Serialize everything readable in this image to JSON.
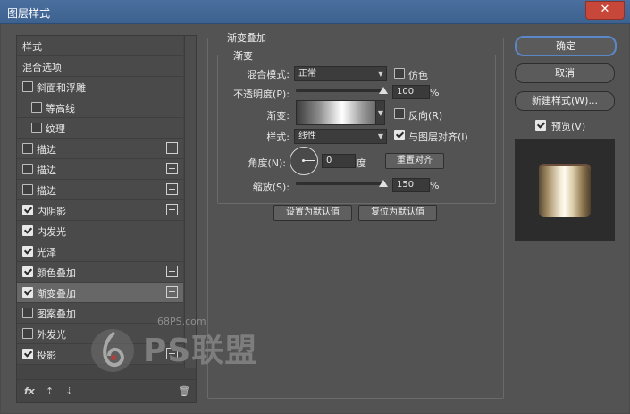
{
  "window": {
    "title": "图层样式",
    "close_icon": "close-icon"
  },
  "styles_list": {
    "items": [
      {
        "label": "样式",
        "has_checkbox": false,
        "checked": false,
        "has_plus": false,
        "selected": false,
        "indent": 0
      },
      {
        "label": "混合选项",
        "has_checkbox": false,
        "checked": false,
        "has_plus": false,
        "selected": false,
        "indent": 0
      },
      {
        "label": "斜面和浮雕",
        "has_checkbox": true,
        "checked": false,
        "has_plus": false,
        "selected": false,
        "indent": 0
      },
      {
        "label": "等高线",
        "has_checkbox": true,
        "checked": false,
        "has_plus": false,
        "selected": false,
        "indent": 1
      },
      {
        "label": "纹理",
        "has_checkbox": true,
        "checked": false,
        "has_plus": false,
        "selected": false,
        "indent": 1
      },
      {
        "label": "描边",
        "has_checkbox": true,
        "checked": false,
        "has_plus": true,
        "selected": false,
        "indent": 0
      },
      {
        "label": "描边",
        "has_checkbox": true,
        "checked": false,
        "has_plus": true,
        "selected": false,
        "indent": 0
      },
      {
        "label": "描边",
        "has_checkbox": true,
        "checked": false,
        "has_plus": true,
        "selected": false,
        "indent": 0
      },
      {
        "label": "内阴影",
        "has_checkbox": true,
        "checked": true,
        "has_plus": true,
        "selected": false,
        "indent": 0
      },
      {
        "label": "内发光",
        "has_checkbox": true,
        "checked": true,
        "has_plus": false,
        "selected": false,
        "indent": 0
      },
      {
        "label": "光泽",
        "has_checkbox": true,
        "checked": true,
        "has_plus": false,
        "selected": false,
        "indent": 0
      },
      {
        "label": "颜色叠加",
        "has_checkbox": true,
        "checked": true,
        "has_plus": true,
        "selected": false,
        "indent": 0
      },
      {
        "label": "渐变叠加",
        "has_checkbox": true,
        "checked": true,
        "has_plus": true,
        "selected": true,
        "indent": 0
      },
      {
        "label": "图案叠加",
        "has_checkbox": true,
        "checked": false,
        "has_plus": false,
        "selected": false,
        "indent": 0
      },
      {
        "label": "外发光",
        "has_checkbox": true,
        "checked": false,
        "has_plus": false,
        "selected": false,
        "indent": 0
      },
      {
        "label": "投影",
        "has_checkbox": true,
        "checked": true,
        "has_plus": true,
        "selected": false,
        "indent": 0
      }
    ],
    "footer": {
      "fx_label": "fx",
      "up_icon": "arrow-up-icon",
      "down_icon": "arrow-down-icon",
      "trash_icon": "trash-icon"
    }
  },
  "gradient_overlay": {
    "group_title": "渐变叠加",
    "subgroup_title": "渐变",
    "blend_mode": {
      "label": "混合模式:",
      "value": "正常"
    },
    "dither": {
      "label": "仿色",
      "checked": false
    },
    "opacity": {
      "label": "不透明度(P):",
      "value": "100",
      "unit": "%",
      "level": 1.0
    },
    "gradient": {
      "label": "渐变:"
    },
    "reverse": {
      "label": "反向(R)",
      "checked": false
    },
    "style": {
      "label": "样式:",
      "value": "线性"
    },
    "align_with_layer": {
      "label": "与图层对齐(I)",
      "checked": true
    },
    "angle": {
      "label": "角度(N):",
      "value": "0",
      "unit": "度"
    },
    "reset_align_button": "重置对齐",
    "scale": {
      "label": "缩放(S):",
      "value": "150",
      "unit": "%",
      "level": 1.0
    },
    "set_default_button": "设置为默认值",
    "reset_default_button": "复位为默认值"
  },
  "actions": {
    "ok": "确定",
    "cancel": "取消",
    "new_style": "新建样式(W)...",
    "preview": {
      "label": "预览(V)",
      "checked": true
    }
  },
  "watermark": {
    "url": "68PS.com",
    "brand": "PS联盟"
  },
  "colors": {
    "title_bar": "#416794",
    "dialog_bg": "#535353",
    "primary_border": "#5a87c8",
    "close_button": "#c7483a"
  }
}
